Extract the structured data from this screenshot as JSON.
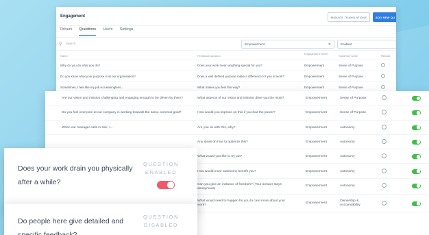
{
  "back_panel": {
    "title": "Engagement",
    "btn_outline": "MANAGE TRANSLATIONS",
    "btn_primary": "ADD NEW QU",
    "tabs": [
      "Drivers",
      "Questions",
      "Users",
      "Settings"
    ],
    "active_tab": "Questions",
    "search_placeholder": "Search",
    "filter_area": "Empowerment",
    "filter_status": "Enabled",
    "columns": [
      "Name",
      "Feedback question",
      "Engagement Driver",
      "Subdriver name",
      "Rebuild"
    ],
    "rows": [
      {
        "q": "Why do you do what you do?",
        "f": "Does your work mean anything special for you?",
        "a": "Empowerment",
        "s": "Sense of Purpose"
      },
      {
        "q": "Do you know what your purpose is at our organisation?",
        "f": "Does a well defined purpose make a difference for you at work?",
        "a": "Empowerment",
        "s": "Sense of Purpose"
      },
      {
        "q": "Sometimes, I feel like my job is meaningless...",
        "f": "What makes you feel this way?",
        "a": "Empowerment",
        "s": "Sense of Purpose"
      }
    ]
  },
  "front_panel": {
    "rows": [
      {
        "q": "Are our vision and mission challenging and engaging enough to be driven by them?",
        "f": "What aspects of our vision and mission drive you the most?",
        "a": "Empowerment",
        "s": "Sense of Purpose",
        "enabled": true
      },
      {
        "q": "Do you feel everyone at our company is working towards the same common goal?",
        "f": "How would you improve on this if you had the power?",
        "a": "Empowerment",
        "s": "Sense of Purpose",
        "enabled": true
      },
      {
        "q": "When our manager calls in sick, I...",
        "f": "Are you ok with this, why?",
        "a": "Empowerment",
        "s": "Autonomy",
        "enabled": true
      },
      {
        "q": "",
        "f": "Any ideas on how to optimize this?",
        "a": "Empowerment",
        "s": "Autonomy",
        "enabled": true
      },
      {
        "q": "",
        "f": "What would you like to try out?",
        "a": "Empowerment",
        "s": "Autonomy",
        "enabled": true
      },
      {
        "q": "",
        "f": "How would more autonomy benefit you?",
        "a": "Empowerment",
        "s": "Autonomy",
        "enabled": true
      },
      {
        "q": "",
        "f": "Can you give an instance of freedom? (Your answer stays anonymous)",
        "a": "Empowerment",
        "s": "Autonomy",
        "enabled": true
      },
      {
        "q": "",
        "f": "What would need to happen for you to care more about your work?",
        "a": "Empowerment",
        "s": "Ownership & Accountability",
        "enabled": true
      }
    ]
  },
  "cards": [
    {
      "question": "Does your work drain you physically after a while?",
      "state": "QUESTION ENABLED",
      "enabled": true
    },
    {
      "question": "Do people here give detailed and specific feedback?",
      "state": "QUESTION DISABLED",
      "enabled": false
    }
  ],
  "colors": {
    "accent": "#2f7de0",
    "toggle_on": "#3fbf4a",
    "toggle_card": "#ef5a6a"
  }
}
